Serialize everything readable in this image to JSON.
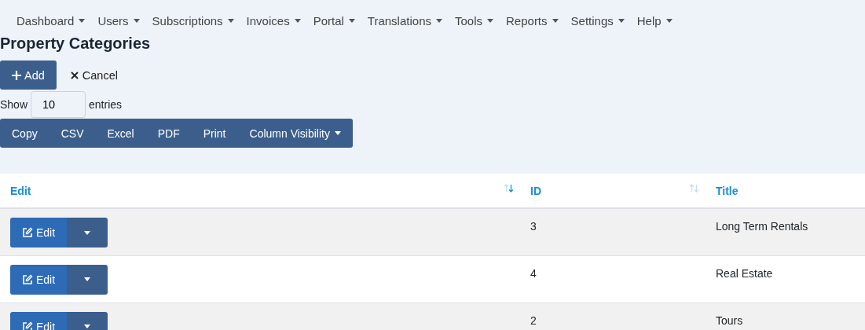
{
  "nav": [
    {
      "label": "Dashboard"
    },
    {
      "label": "Users"
    },
    {
      "label": "Subscriptions"
    },
    {
      "label": "Invoices"
    },
    {
      "label": "Portal"
    },
    {
      "label": "Translations"
    },
    {
      "label": "Tools"
    },
    {
      "label": "Reports"
    },
    {
      "label": "Settings"
    },
    {
      "label": "Help"
    }
  ],
  "title": "Property Categories",
  "actions": [
    {
      "kind": "add",
      "label": "Add"
    },
    {
      "kind": "cancel",
      "label": "Cancel"
    }
  ],
  "length": {
    "before": "Show",
    "value": "10",
    "after": "entries"
  },
  "export_buttons": [
    {
      "label": "Copy",
      "dropdown": false
    },
    {
      "label": "CSV",
      "dropdown": false
    },
    {
      "label": "Excel",
      "dropdown": false
    },
    {
      "label": "PDF",
      "dropdown": false
    },
    {
      "label": "Print",
      "dropdown": false
    },
    {
      "label": "Column Visibility",
      "dropdown": true
    }
  ],
  "table": {
    "columns": [
      {
        "label": "Edit",
        "sorted": true
      },
      {
        "label": "ID",
        "sorted": false
      },
      {
        "label": "Title"
      }
    ],
    "rows": [
      {
        "edit_label": "Edit",
        "id": "3",
        "title": "Long Term Rentals"
      },
      {
        "edit_label": "Edit",
        "id": "4",
        "title": "Real Estate"
      },
      {
        "edit_label": "Edit",
        "id": "2",
        "title": "Tours"
      }
    ]
  }
}
